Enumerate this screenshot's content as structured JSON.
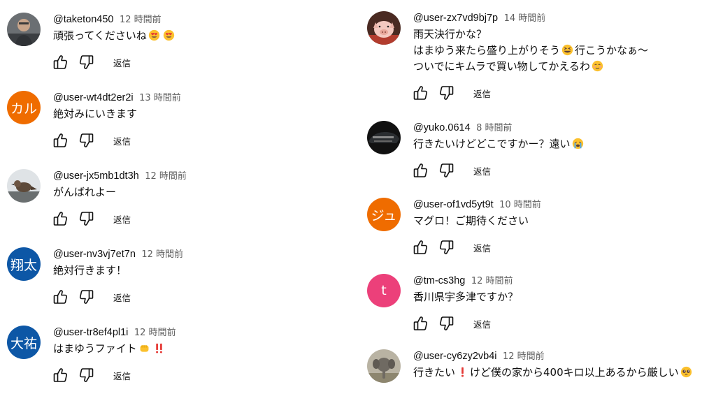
{
  "reply_label": "返信",
  "colors": {
    "avatar_orange": "#ef6c00",
    "avatar_blue": "#0d57a6",
    "avatar_pink": "#ec407a",
    "time_gray": "#606060"
  },
  "left_comments": [
    {
      "author": "@taketon450",
      "time": "12 時間前",
      "lines": [
        "頑張ってくださいね"
      ],
      "avatar_text": "",
      "avatar_icon": "photo-avatar-icon",
      "emoji": [
        "heart-eyes-emoji",
        "heart-eyes-emoji"
      ]
    },
    {
      "author": "@user-wt4dt2er2i",
      "time": "13 時間前",
      "lines": [
        "絶対みにいきます"
      ],
      "avatar_text": "カル",
      "avatar_color": "#ef6c00"
    },
    {
      "author": "@user-jx5mb1dt3h",
      "time": "12 時間前",
      "lines": [
        "がんばれよー"
      ],
      "avatar_text": "",
      "avatar_icon": "bird-avatar-icon"
    },
    {
      "author": "@user-nv3vj7et7n",
      "time": "12 時間前",
      "lines": [
        "絶対行きます！"
      ],
      "avatar_text": "翔太",
      "avatar_color": "#0d57a6"
    },
    {
      "author": "@user-tr8ef4pl1i",
      "time": "12 時間前",
      "lines": [
        "はまゆうファイト"
      ],
      "avatar_text": "大祐",
      "avatar_color": "#0d57a6",
      "emoji": [
        "raised-fist-emoji",
        "double-exclamation-emoji"
      ]
    }
  ],
  "right_comments": [
    {
      "author": "@user-zx7vd9bj7p",
      "time": "14 時間前",
      "lines": [
        "雨天決行かな？",
        "はまゆう来たら盛り上がりそう",
        "行こうかなぁ～",
        "ついでにキムラで買い物してかえるわ"
      ],
      "avatar_text": "",
      "avatar_icon": "pig-avatar-icon",
      "emoji": [
        "grin-squint-emoji",
        "smiling-blush-emoji"
      ]
    },
    {
      "author": "@yuko.0614",
      "time": "8 時間前",
      "lines": [
        "行きたいけどどこですかー？遠い"
      ],
      "avatar_text": "",
      "avatar_icon": "car-avatar-icon",
      "emoji": [
        "crying-emoji"
      ]
    },
    {
      "author": "@user-of1vd5yt9t",
      "time": "10 時間前",
      "lines": [
        "マグロ！ご期待ください"
      ],
      "avatar_text": "ジュ",
      "avatar_color": "#ef6c00"
    },
    {
      "author": "@tm-cs3hg",
      "time": "12 時間前",
      "lines": [
        "香川県宇多津ですか？"
      ],
      "avatar_text": "t",
      "avatar_color": "#ec407a"
    },
    {
      "author": "@user-cy6zy2vb4i",
      "time": "12 時間前",
      "lines": [
        "行きたい",
        "けど僕の家から400キロ以上あるから厳しい"
      ],
      "avatar_text": "",
      "avatar_icon": "elephant-avatar-icon",
      "emoji": [
        "red-exclamation-emoji",
        "pleading-emoji"
      ]
    }
  ]
}
